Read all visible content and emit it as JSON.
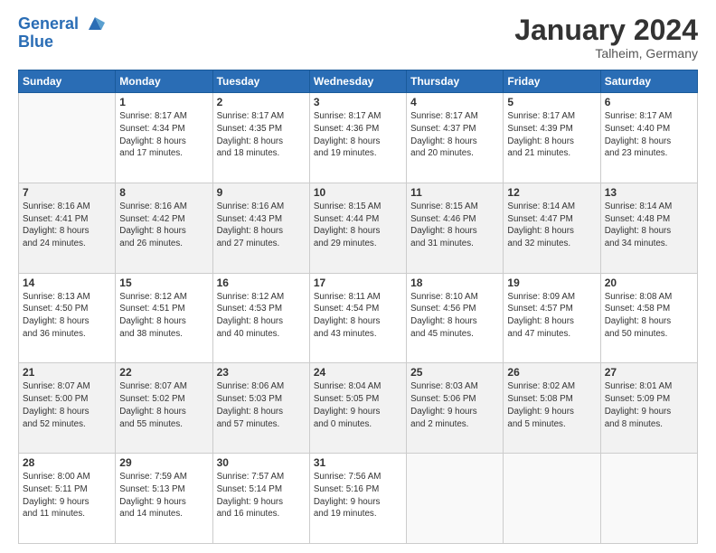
{
  "logo": {
    "line1": "General",
    "line2": "Blue"
  },
  "title": "January 2024",
  "location": "Talheim, Germany",
  "days_header": [
    "Sunday",
    "Monday",
    "Tuesday",
    "Wednesday",
    "Thursday",
    "Friday",
    "Saturday"
  ],
  "weeks": [
    [
      {
        "num": "",
        "sunrise": "",
        "sunset": "",
        "daylight": ""
      },
      {
        "num": "1",
        "sunrise": "Sunrise: 8:17 AM",
        "sunset": "Sunset: 4:34 PM",
        "daylight": "Daylight: 8 hours and 17 minutes."
      },
      {
        "num": "2",
        "sunrise": "Sunrise: 8:17 AM",
        "sunset": "Sunset: 4:35 PM",
        "daylight": "Daylight: 8 hours and 18 minutes."
      },
      {
        "num": "3",
        "sunrise": "Sunrise: 8:17 AM",
        "sunset": "Sunset: 4:36 PM",
        "daylight": "Daylight: 8 hours and 19 minutes."
      },
      {
        "num": "4",
        "sunrise": "Sunrise: 8:17 AM",
        "sunset": "Sunset: 4:37 PM",
        "daylight": "Daylight: 8 hours and 20 minutes."
      },
      {
        "num": "5",
        "sunrise": "Sunrise: 8:17 AM",
        "sunset": "Sunset: 4:39 PM",
        "daylight": "Daylight: 8 hours and 21 minutes."
      },
      {
        "num": "6",
        "sunrise": "Sunrise: 8:17 AM",
        "sunset": "Sunset: 4:40 PM",
        "daylight": "Daylight: 8 hours and 23 minutes."
      }
    ],
    [
      {
        "num": "7",
        "sunrise": "Sunrise: 8:16 AM",
        "sunset": "Sunset: 4:41 PM",
        "daylight": "Daylight: 8 hours and 24 minutes."
      },
      {
        "num": "8",
        "sunrise": "Sunrise: 8:16 AM",
        "sunset": "Sunset: 4:42 PM",
        "daylight": "Daylight: 8 hours and 26 minutes."
      },
      {
        "num": "9",
        "sunrise": "Sunrise: 8:16 AM",
        "sunset": "Sunset: 4:43 PM",
        "daylight": "Daylight: 8 hours and 27 minutes."
      },
      {
        "num": "10",
        "sunrise": "Sunrise: 8:15 AM",
        "sunset": "Sunset: 4:44 PM",
        "daylight": "Daylight: 8 hours and 29 minutes."
      },
      {
        "num": "11",
        "sunrise": "Sunrise: 8:15 AM",
        "sunset": "Sunset: 4:46 PM",
        "daylight": "Daylight: 8 hours and 31 minutes."
      },
      {
        "num": "12",
        "sunrise": "Sunrise: 8:14 AM",
        "sunset": "Sunset: 4:47 PM",
        "daylight": "Daylight: 8 hours and 32 minutes."
      },
      {
        "num": "13",
        "sunrise": "Sunrise: 8:14 AM",
        "sunset": "Sunset: 4:48 PM",
        "daylight": "Daylight: 8 hours and 34 minutes."
      }
    ],
    [
      {
        "num": "14",
        "sunrise": "Sunrise: 8:13 AM",
        "sunset": "Sunset: 4:50 PM",
        "daylight": "Daylight: 8 hours and 36 minutes."
      },
      {
        "num": "15",
        "sunrise": "Sunrise: 8:12 AM",
        "sunset": "Sunset: 4:51 PM",
        "daylight": "Daylight: 8 hours and 38 minutes."
      },
      {
        "num": "16",
        "sunrise": "Sunrise: 8:12 AM",
        "sunset": "Sunset: 4:53 PM",
        "daylight": "Daylight: 8 hours and 40 minutes."
      },
      {
        "num": "17",
        "sunrise": "Sunrise: 8:11 AM",
        "sunset": "Sunset: 4:54 PM",
        "daylight": "Daylight: 8 hours and 43 minutes."
      },
      {
        "num": "18",
        "sunrise": "Sunrise: 8:10 AM",
        "sunset": "Sunset: 4:56 PM",
        "daylight": "Daylight: 8 hours and 45 minutes."
      },
      {
        "num": "19",
        "sunrise": "Sunrise: 8:09 AM",
        "sunset": "Sunset: 4:57 PM",
        "daylight": "Daylight: 8 hours and 47 minutes."
      },
      {
        "num": "20",
        "sunrise": "Sunrise: 8:08 AM",
        "sunset": "Sunset: 4:58 PM",
        "daylight": "Daylight: 8 hours and 50 minutes."
      }
    ],
    [
      {
        "num": "21",
        "sunrise": "Sunrise: 8:07 AM",
        "sunset": "Sunset: 5:00 PM",
        "daylight": "Daylight: 8 hours and 52 minutes."
      },
      {
        "num": "22",
        "sunrise": "Sunrise: 8:07 AM",
        "sunset": "Sunset: 5:02 PM",
        "daylight": "Daylight: 8 hours and 55 minutes."
      },
      {
        "num": "23",
        "sunrise": "Sunrise: 8:06 AM",
        "sunset": "Sunset: 5:03 PM",
        "daylight": "Daylight: 8 hours and 57 minutes."
      },
      {
        "num": "24",
        "sunrise": "Sunrise: 8:04 AM",
        "sunset": "Sunset: 5:05 PM",
        "daylight": "Daylight: 9 hours and 0 minutes."
      },
      {
        "num": "25",
        "sunrise": "Sunrise: 8:03 AM",
        "sunset": "Sunset: 5:06 PM",
        "daylight": "Daylight: 9 hours and 2 minutes."
      },
      {
        "num": "26",
        "sunrise": "Sunrise: 8:02 AM",
        "sunset": "Sunset: 5:08 PM",
        "daylight": "Daylight: 9 hours and 5 minutes."
      },
      {
        "num": "27",
        "sunrise": "Sunrise: 8:01 AM",
        "sunset": "Sunset: 5:09 PM",
        "daylight": "Daylight: 9 hours and 8 minutes."
      }
    ],
    [
      {
        "num": "28",
        "sunrise": "Sunrise: 8:00 AM",
        "sunset": "Sunset: 5:11 PM",
        "daylight": "Daylight: 9 hours and 11 minutes."
      },
      {
        "num": "29",
        "sunrise": "Sunrise: 7:59 AM",
        "sunset": "Sunset: 5:13 PM",
        "daylight": "Daylight: 9 hours and 14 minutes."
      },
      {
        "num": "30",
        "sunrise": "Sunrise: 7:57 AM",
        "sunset": "Sunset: 5:14 PM",
        "daylight": "Daylight: 9 hours and 16 minutes."
      },
      {
        "num": "31",
        "sunrise": "Sunrise: 7:56 AM",
        "sunset": "Sunset: 5:16 PM",
        "daylight": "Daylight: 9 hours and 19 minutes."
      },
      {
        "num": "",
        "sunrise": "",
        "sunset": "",
        "daylight": ""
      },
      {
        "num": "",
        "sunrise": "",
        "sunset": "",
        "daylight": ""
      },
      {
        "num": "",
        "sunrise": "",
        "sunset": "",
        "daylight": ""
      }
    ]
  ]
}
